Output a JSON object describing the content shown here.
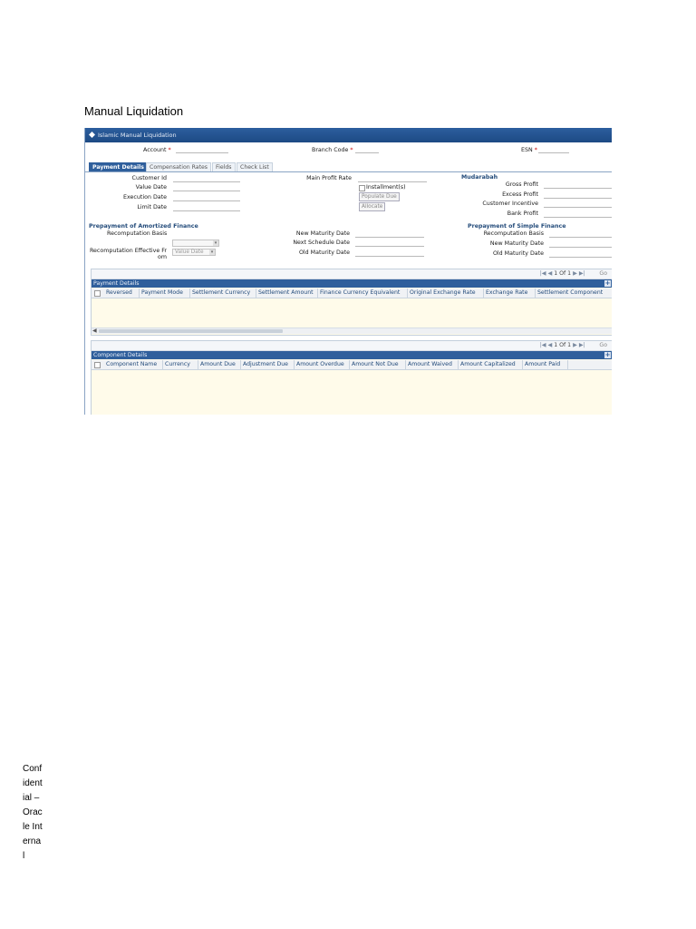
{
  "document": {
    "heading": "Manual Liquidation",
    "footer": "Confidential – Oracle Internal"
  },
  "window": {
    "title": "Islamic Manual Liquidation"
  },
  "header_fields": {
    "account_label": "Account",
    "branch_code_label": "Branch Code",
    "esn_label": "ESN",
    "required_mark": "*"
  },
  "tabs": [
    {
      "label": "Payment Details",
      "active": true
    },
    {
      "label": "Compensation Rates",
      "active": false
    },
    {
      "label": "Fields",
      "active": false
    },
    {
      "label": "Check List",
      "active": false
    }
  ],
  "payment_details": {
    "customer_id_label": "Customer Id",
    "value_date_label": "Value Date",
    "execution_date_label": "Execution Date",
    "limit_date_label": "Limit Date",
    "main_profit_rate_label": "Main Profit Rate",
    "installments_label": "Installment(s)",
    "populate_due_label": "Populate Due",
    "allocate_label": "Allocate"
  },
  "mudarabah": {
    "title": "Mudarabah",
    "gross_profit_label": "Gross Profit",
    "excess_profit_label": "Excess Profit",
    "customer_incentive_label": "Customer Incentive",
    "bank_profit_label": "Bank Profit"
  },
  "prepayment_amortized": {
    "title": "Prepayment of Amortized Finance",
    "recomputation_basis_label": "Recomputation Basis",
    "recomputation_effective_label_1": "Recomputation Effective Fr",
    "recomputation_effective_label_2": "om",
    "recomputation_effective_value": "Value Date",
    "new_maturity_date_label": "New Maturity Date",
    "next_schedule_date_label": "Next Schedule Date",
    "old_maturity_date_label": "Old Maturity Date"
  },
  "prepayment_simple": {
    "title": "Prepayment of Simple Finance",
    "recomputation_basis_label": "Recomputation Basis",
    "new_maturity_date_label": "New Maturity Date",
    "old_maturity_date_label": "Old Maturity Date"
  },
  "payment_grid": {
    "title": "Payment Details",
    "pager": "1 Of 1",
    "go_label": "Go",
    "columns": [
      "Reversed",
      "Payment Mode",
      "Settlement Currency",
      "Settlement Amount",
      "Finance Currency Equivalent",
      "Original Exchange Rate",
      "Exchange Rate",
      "Settlement Component"
    ]
  },
  "component_grid": {
    "title": "Component Details",
    "pager": "1 Of 1",
    "go_label": "Go",
    "columns": [
      "Component Name",
      "Currency",
      "Amount Due",
      "Adjustment Due",
      "Amount Overdue",
      "Amount Not Due",
      "Amount Waived",
      "Amount Capitalized",
      "Amount Paid"
    ]
  },
  "colors": {
    "title_bar": "#2c5e9e",
    "section_text": "#234b7a",
    "grid_body": "#fffbea",
    "required": "#cc0000"
  }
}
